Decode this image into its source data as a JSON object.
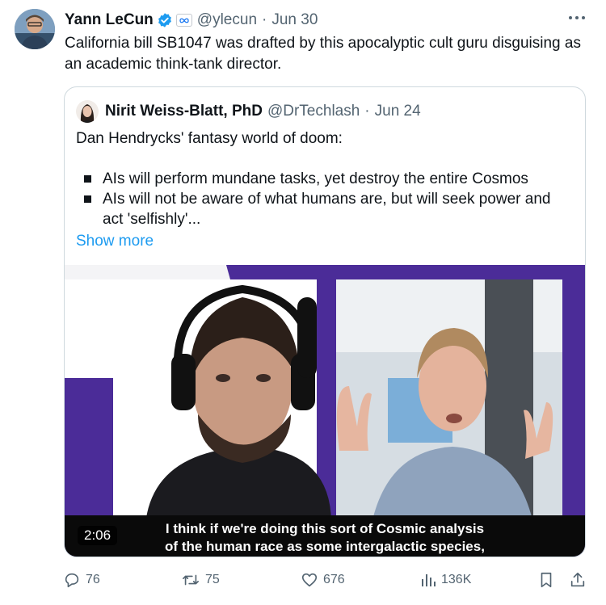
{
  "author": {
    "name": "Yann LeCun",
    "handle": "@ylecun",
    "separator": "·",
    "date": "Jun 30"
  },
  "tweet": {
    "text": "California bill SB1047 was drafted by this apocalyptic cult guru disguising as an academic think-tank director."
  },
  "quoted": {
    "name": "Nirit Weiss-Blatt, PhD",
    "handle": "@DrTechlash",
    "separator": "·",
    "date": "Jun 24",
    "intro": "Dan Hendrycks' fantasy world of doom:",
    "bullets": [
      "AIs will perform mundane tasks, yet destroy the entire Cosmos",
      "AIs will not be aware of what humans are, but will seek power and act 'selfishly'..."
    ],
    "show_more": "Show more",
    "video": {
      "duration": "2:06",
      "caption_line1": "I think if we're doing this sort of Cosmic analysis",
      "caption_line2": "of the human race as some intergalactic species,"
    }
  },
  "metrics": {
    "replies": "76",
    "reposts": "75",
    "likes": "676",
    "views": "136K"
  },
  "colors": {
    "accent": "#1d9bf0",
    "muted": "#536471",
    "video_purple": "#4b2c98",
    "text": "#0f1419"
  },
  "icons": [
    "verified-badge-icon",
    "affiliate-badge-icon",
    "more-options-icon",
    "reply-icon",
    "repost-icon",
    "like-icon",
    "views-icon",
    "bookmark-icon",
    "share-icon"
  ]
}
